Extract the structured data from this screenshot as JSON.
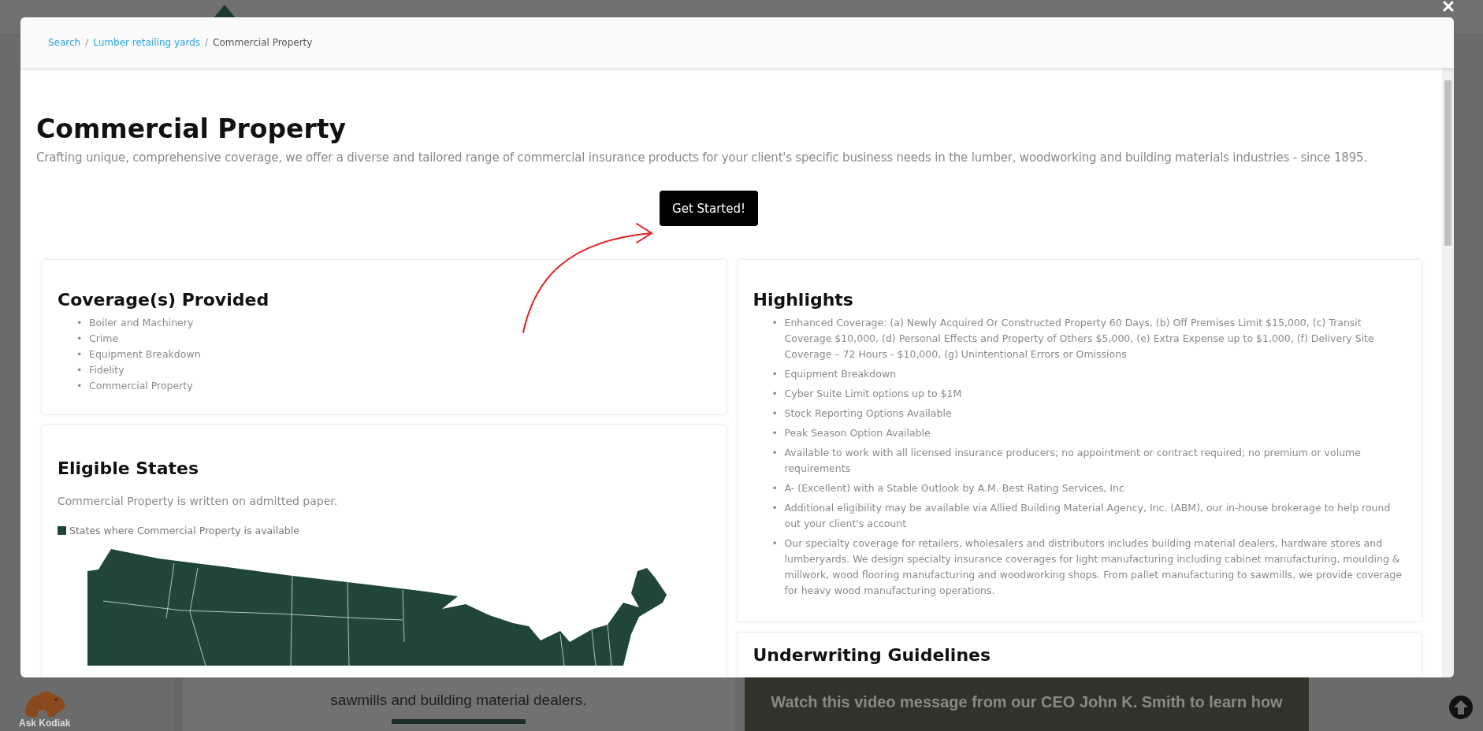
{
  "background_page": {
    "logo_text": "Ask Kodiak",
    "intro_lines": [
      "sawmills and building material dealers."
    ],
    "video_text": "Watch this video message from our CEO John K. Smith to learn how"
  },
  "modal": {
    "breadcrumb_separator": "/",
    "bullet": "•",
    "breadcrumb": [
      {
        "label": "Search",
        "link": true
      },
      {
        "label": "Lumber retailing yards",
        "link": true
      },
      {
        "label": "Commercial Property",
        "link": false
      }
    ],
    "title": "Commercial Property",
    "subtitle": "Crafting unique, comprehensive coverage, we offer a diverse and tailored range of commercial insurance products for your client's specific business needs in the lumber, woodworking and building materials industries - since 1895.",
    "button": "Get Started!",
    "coverage": {
      "title": "Coverage(s) Provided",
      "items": [
        "Boiler and Machinery",
        "Crime",
        "Equipment Breakdown",
        "Fidelity",
        "Commercial Property"
      ]
    },
    "eligible": {
      "title": "Eligible States",
      "note": "Commercial Property is written on admitted paper.",
      "legend": {
        "label": "States where Commercial Property is available",
        "color": "#1f4638"
      }
    },
    "highlights": {
      "title": "Highlights",
      "items": [
        "Enhanced Coverage: (a) Newly Acquired Or Constructed Property 60 Days, (b) Off Premises Limit $15,000, (c) Transit Coverage $10,000, (d) Personal Effects and Property of Others $5,000, (e) Extra Expense up to $1,000, (f) Delivery Site Coverage – 72 Hours - $10,000, (g) Unintentional Errors or Omissions",
        "Equipment Breakdown",
        "Cyber Suite Limit options up to $1M",
        "Stock Reporting Options Available",
        "Peak Season Option Available",
        "Available to work with all licensed insurance producers; no appointment or contract required; no premium or volume requirements",
        "A- (Excellent) with a Stable Outlook by A.M. Best Rating Services, Inc",
        "Additional eligibility may be available via Allied Building Material Agency, Inc. (ABM), our in-house brokerage to help round out your client's account",
        "Our specialty coverage for retailers, wholesalers and distributors includes building material dealers, hardware stores and lumberyards. We design specialty insurance coverages for light manufacturing including cabinet manufacturing, moulding & millwork, wood flooring manufacturing and woodworking shops. From pallet manufacturing to sawmills, we provide coverage for heavy wood manufacturing operations."
      ]
    },
    "underwriting": {
      "title": "Underwriting Guidelines"
    }
  }
}
